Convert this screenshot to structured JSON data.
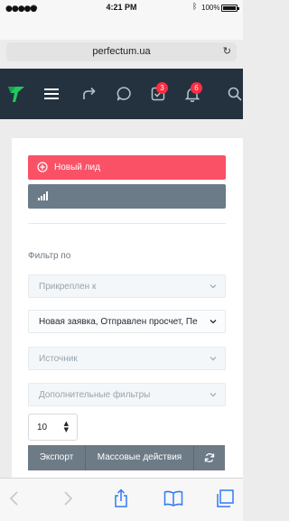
{
  "status_bar": {
    "time": "4:21 PM",
    "battery": "100%",
    "signal_icon": "signal-dots-icon",
    "wifi_icon": "wifi-icon",
    "bluetooth_icon": "bluetooth-icon"
  },
  "browser": {
    "url": "perfectum.ua",
    "reload_icon": "reload-icon"
  },
  "header": {
    "logo": "perfectum-logo",
    "icons": [
      "menu-icon",
      "share-arrow-icon",
      "chat-bubble-icon",
      "tasks-checkbox-icon",
      "bell-icon",
      "search-icon"
    ],
    "tasks_badge": "3",
    "notifications_badge": "6",
    "background": "#24323f"
  },
  "actions": {
    "new_lead_label": "Новый лид",
    "new_lead_color": "#fb5166",
    "chart_icon": "bar-chart-icon"
  },
  "filters": {
    "title": "Фильтр по",
    "assigned_placeholder": "Прикреплен к",
    "status_value": "Новая заявка, Отправлен просчет, Пе",
    "source_placeholder": "Источник",
    "extra_placeholder": "Дополнительные фильтры"
  },
  "table_controls": {
    "per_page": "10",
    "export_label": "Экспорт",
    "bulk_label": "Массовые действия",
    "refresh_icon": "refresh-icon"
  },
  "toolbar": {
    "icons": [
      "back-icon",
      "forward-icon",
      "share-icon",
      "bookmarks-icon",
      "tabs-icon"
    ]
  }
}
